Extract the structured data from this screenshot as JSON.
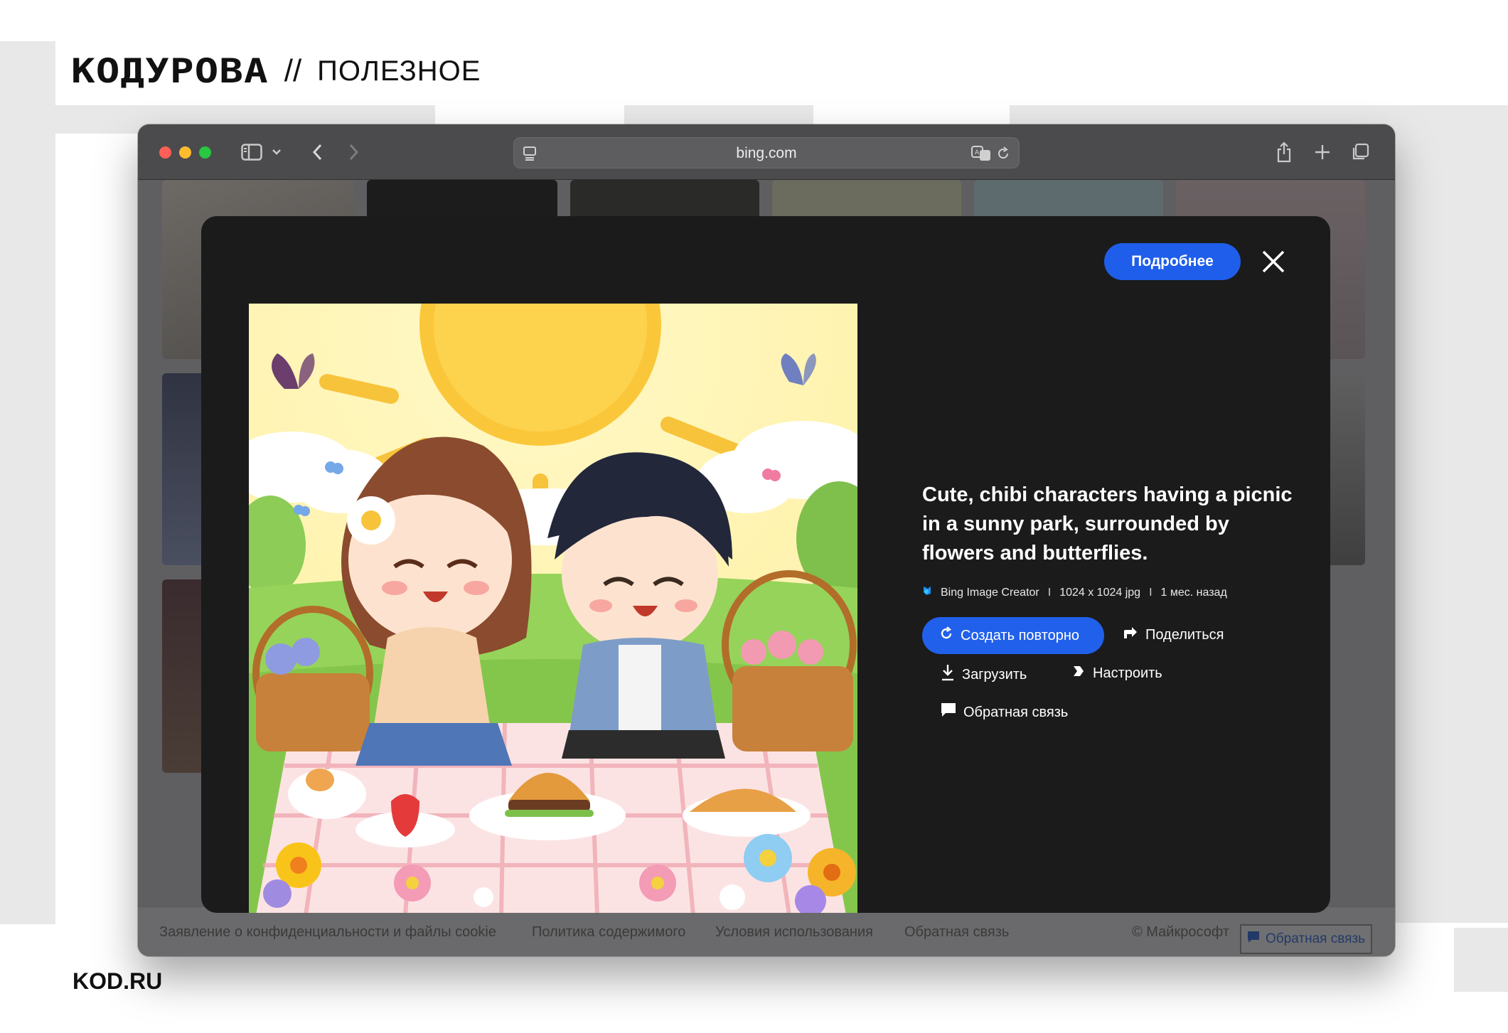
{
  "header": {
    "brand": "КОДУРОВА",
    "separator": "//",
    "section": "ПОЛЕЗНОЕ"
  },
  "footer": {
    "site": "KOD.RU"
  },
  "browser": {
    "address": "bing.com"
  },
  "modal": {
    "more_button": "Подробнее",
    "title": "Cute, chibi characters having a picnic in a sunny park, surrounded by flowers and butterflies.",
    "meta": {
      "source": "Bing Image Creator",
      "separator": "I",
      "dimensions": "1024 x 1024 jpg",
      "time": "1 мес. назад"
    },
    "actions": {
      "recreate": "Создать повторно",
      "share": "Поделиться",
      "download": "Загрузить",
      "customize": "Настроить",
      "feedback": "Обратная связь"
    }
  },
  "page_footer": {
    "links": [
      "Заявление о конфиденциальности и файлы cookie",
      "Политика содержимого",
      "Условия использования",
      "Обратная связь"
    ],
    "copyright": "© Майкрософт",
    "feedback_button": "Обратная связь"
  },
  "colors": {
    "accent_blue": "#1f5eea",
    "modal_bg": "#1b1b1b",
    "traffic_red": "#ff5f57",
    "traffic_yellow": "#febc2e",
    "traffic_green": "#28c840"
  }
}
